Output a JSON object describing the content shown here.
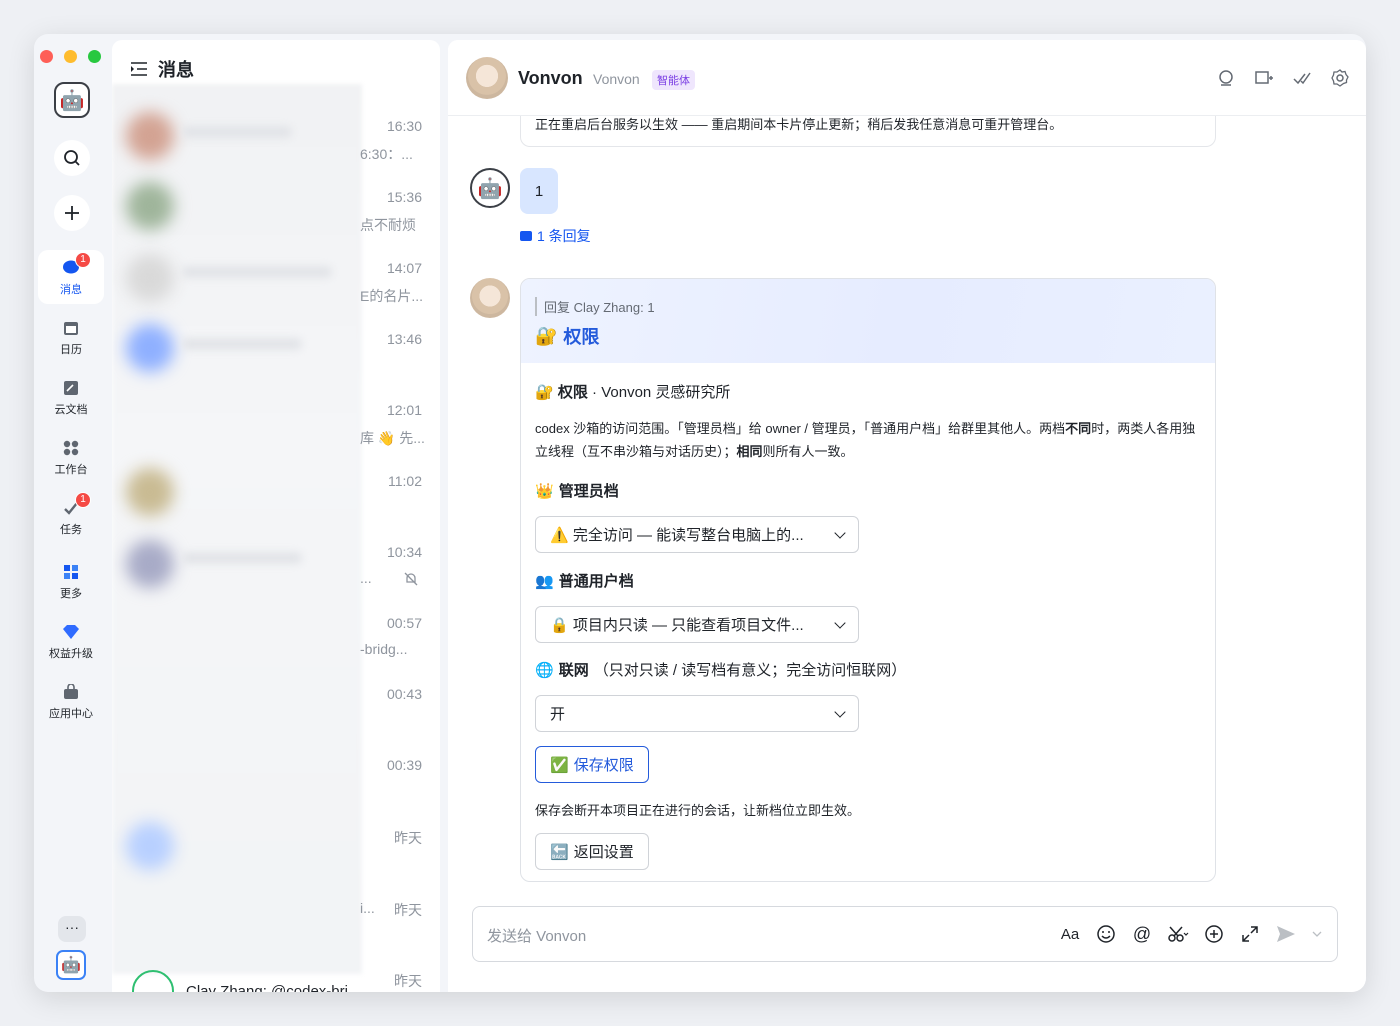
{
  "sidebar": {
    "items": [
      {
        "label": "消息",
        "badge": "1"
      },
      {
        "label": "日历"
      },
      {
        "label": "云文档"
      },
      {
        "label": "工作台"
      },
      {
        "label": "任务",
        "badge": "1"
      },
      {
        "label": "更多"
      },
      {
        "label": "权益升级"
      },
      {
        "label": "应用中心"
      }
    ],
    "more": "···"
  },
  "list": {
    "title": "消息",
    "rows": [
      {
        "time": "16:30",
        "snippet": "6:30：..."
      },
      {
        "time": "15:36",
        "snippet": "点不耐烦"
      },
      {
        "time": "14:07",
        "snippet": "E的名片..."
      },
      {
        "time": "13:46",
        "snippet": ""
      },
      {
        "time": "12:01",
        "snippet": "库 👋 先..."
      },
      {
        "time": "11:02",
        "snippet": ""
      },
      {
        "time": "10:34",
        "snippet": "..."
      },
      {
        "time": "00:57",
        "snippet": "-bridg..."
      },
      {
        "time": "00:43",
        "snippet": ""
      },
      {
        "time": "00:39",
        "snippet": ""
      },
      {
        "time": "昨天",
        "snippet": ""
      },
      {
        "time": "昨天",
        "snippet": "i..."
      }
    ],
    "last": {
      "name": "Clay Zhang: @codex-bri...",
      "time": "昨天"
    }
  },
  "chat": {
    "name": "Vonvon",
    "alias": "Vonvon",
    "tag": "智能体",
    "prev_text": "正在重启后台服务以生效 —— 重启期间本卡片停止更新；稍后发我任意消息可重开管理台。",
    "bubble": "1",
    "reply_count": "1 条回复",
    "card": {
      "quote": "回复 Clay Zhang:  1",
      "title": "权限",
      "title_emoji": "🔐",
      "subtitle_bold": "权限",
      "subtitle_rest": " · Vonvon 灵感研究所",
      "desc_1": "codex 沙箱的访问范围。「管理员档」给 owner / 管理员，「普通用户档」给群里其他人。两档",
      "desc_bold_1": "不同",
      "desc_2": "时，两类人各用独立线程（互不串沙箱与对话历史）；",
      "desc_bold_2": "相同",
      "desc_3": "则所有人一致。",
      "admin_label": "管理员档",
      "admin_emoji": "👑",
      "admin_value": "⚠️ 完全访问 — 能读写整台电脑上的...",
      "user_label": "普通用户档",
      "user_emoji": "👥",
      "user_value": "🔒 项目内只读 — 只能查看项目文件...",
      "net_label": "联网",
      "net_emoji": "🌐",
      "net_note": "（只对只读 / 读写档有意义；完全访问恒联网）",
      "net_value": "开",
      "save_label": "保存权限",
      "save_emoji": "✅",
      "hint": "保存会断开本项目正在进行的会话，让新档位立即生效。",
      "back_label": "返回设置",
      "back_emoji": "🔙"
    },
    "composer_placeholder": "发送给 Vonvon"
  },
  "colors": {
    "accent": "#245bdb",
    "badge": "#f54a45",
    "tag": "#7b3fe4"
  }
}
